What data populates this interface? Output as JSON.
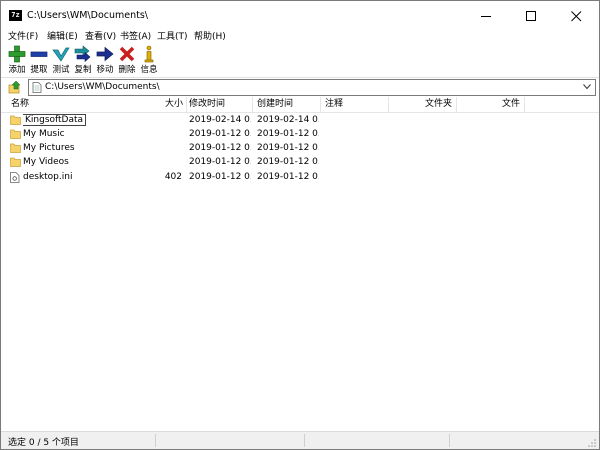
{
  "window": {
    "title": "C:\\Users\\WM\\Documents\\",
    "app_icon_text": "7z"
  },
  "menu": [
    "文件(F)",
    "编辑(E)",
    "查看(V)",
    "书签(A)",
    "工具(T)",
    "帮助(H)"
  ],
  "toolbar": {
    "add": "添加",
    "extract": "提取",
    "test": "测试",
    "copy": "复制",
    "move": "移动",
    "delete": "删除",
    "info": "信息"
  },
  "address": {
    "path": "C:\\Users\\WM\\Documents\\"
  },
  "columns": {
    "name": "名称",
    "size": "大小",
    "modified": "修改时间",
    "created": "创建时间",
    "comment": "注释",
    "folders": "文件夹",
    "files": "文件"
  },
  "files": [
    {
      "name": "KingsoftData",
      "size": "",
      "modified": "2019-02-14 0...",
      "created": "2019-02-14 0...",
      "type": "folder"
    },
    {
      "name": "My Music",
      "size": "",
      "modified": "2019-01-12 0...",
      "created": "2019-01-12 0...",
      "type": "folder"
    },
    {
      "name": "My Pictures",
      "size": "",
      "modified": "2019-01-12 0...",
      "created": "2019-01-12 0...",
      "type": "folder"
    },
    {
      "name": "My Videos",
      "size": "",
      "modified": "2019-01-12 0...",
      "created": "2019-01-12 0...",
      "type": "folder"
    },
    {
      "name": "desktop.ini",
      "size": "402",
      "modified": "2019-01-12 0...",
      "created": "2019-01-12 0...",
      "type": "file"
    }
  ],
  "status": {
    "selection": "选定 0 / 5 个项目"
  },
  "colors": {
    "folder": "#f6d26b",
    "add": "#2e9b2e",
    "extract": "#1f3fa8",
    "test": "#27a3b8",
    "copy": "#1d8f9a",
    "move": "#1c2f8f",
    "delete": "#c8201f",
    "info": "#e0b000"
  }
}
